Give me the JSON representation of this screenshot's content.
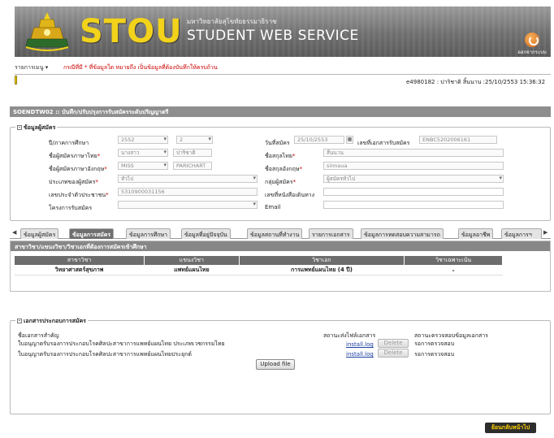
{
  "header": {
    "brand": "STOU",
    "university_th": "มหาวิทยาลัยสุโขทัยธรรมาธิราช",
    "service": "STUDENT WEB SERVICE",
    "logout_label": "ออกจากระบบ"
  },
  "menubar": {
    "menu_label": "รายการเมนู ▾",
    "notice": "กรณีที่มี * ที่ข้อมูลใด หมายถึง เป็นข้อมูลที่ต้องบันทึกให้ครบถ้วน"
  },
  "user_info": "e4980182 : ปาริชาติ สิ้นนาน :25/10/2553 15:36:32",
  "page_title": "SOENDTW02 :: บันทึก/ปรับปรุงการรับสมัครระดับปริญญาตรี",
  "applicant": {
    "legend": "ข้อมูลผู้สมัคร",
    "fields": {
      "year_label": "ปี/ภาคการศึกษา",
      "year_value": "2552",
      "term_value": "2",
      "apply_date_label": "วันที่สมัคร",
      "apply_date_value": "25/10/2553",
      "doc_no_label": "เลขที่เอกสารรับสมัคร",
      "doc_no_value": "ENBC5202006161",
      "prefix_th_label": "ชื่อผู้สมัครภาษาไทย",
      "prefix_th_value": "นางสาว",
      "firstname_th_value": "ปาริชาติ",
      "lastname_th_label": "ชื่อสกุลไทย",
      "lastname_th_value": "สิ้นนาน",
      "prefix_en_label": "ชื่อผู้สมัครภาษาอังกฤษ",
      "prefix_en_value": "MISS",
      "firstname_en_value": "PARICHART",
      "lastname_en_label": "ชื่อสกุลอังกฤษ",
      "lastname_en_value": "sinnaua",
      "type_label": "ประเภทของผู้สมัคร",
      "type_value": "ทั่วไป",
      "group_label": "กลุ่มผู้สมัคร",
      "group_value": "ผู้สมัครทั่วไป",
      "id_label": "เลขประจำตัวประชาชน",
      "id_value": "5310900031156",
      "passport_label": "เลขที่หนังสือเดินทาง",
      "passport_value": "",
      "project_label": "โครงการรับสมัคร",
      "project_value": "",
      "email_label": "Email",
      "email_value": ""
    }
  },
  "tabs": [
    "ข้อมูลผู้สมัคร",
    "ข้อมูลการสมัคร",
    "ข้อมูลการศึกษา",
    "ข้อมูลที่อยู่ปัจจุบัน",
    "ข้อมูลสถานที่ทำงาน",
    "รายการเอกสาร",
    "ข้อมูลการทดสอบความสามารถ",
    "ข้อมูลอาชีพ",
    "ข้อมูลการฯ"
  ],
  "program": {
    "title": "สาขาวิชา/แขนงวิชา/วิชาเอกที่ต้องการสมัครเข้าศึกษา",
    "columns": [
      "สาขาวิชา",
      "แขนงวิชา",
      "วิชาเอก",
      "วิชาเฉพาะเน้น"
    ],
    "rows": [
      [
        "วิทยาศาสตร์สุขภาพ",
        "แพทย์แผนไทย",
        "การแพทย์แผนไทย (4 ปี)",
        "-"
      ]
    ]
  },
  "documents": {
    "legend": "เอกสารประกอบการสมัคร",
    "col_doc": "ชื่อเอกสารสำคัญ",
    "col_status": "สถานะส่งไฟล์เอกสาร",
    "col_check": "สถานะตรวจสอบข้อมูลเอกสาร",
    "items": [
      {
        "name": "ใบอนุญาตรับรองการประกอบโรคศิลปะสาขาการแพทย์แผนไทย ประเภทเวชกรรมไทย",
        "file": "install.log",
        "delete": "Delete",
        "check": "รอการตรวจสอบ"
      },
      {
        "name": "ใบอนุญาตรับรองการประกอบโรคศิลปะสาขาการแพทย์แผนไทยประยุกต์",
        "file": "install.log",
        "delete": "Delete",
        "check": "รอการตรวจสอบ"
      }
    ],
    "upload_label": "Upload file"
  },
  "back_label": "ย้อนกลับหน้าไป"
}
